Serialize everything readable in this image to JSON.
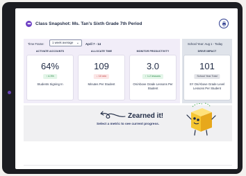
{
  "header": {
    "title": "Class Snapshot: Ms. Tan's Sixth Grade 7th Period"
  },
  "filters": {
    "time_frame_label": "Time Frame:",
    "time_frame_value": "1 week average",
    "date_range": "April 7 - 14"
  },
  "cards": [
    {
      "header": "ACTIVATE ACCOUNTS",
      "value": "64%",
      "badge": "↑ 4.3%",
      "label": "Students Signing In"
    },
    {
      "header": "ALLOCATE TIME",
      "value": "109",
      "badge": "↓ 10 min",
      "label": "Minutes Per Student"
    },
    {
      "header": "MONITOR PRODUCTIVITY",
      "value": "3.0",
      "badge": "↑ 1.2 lessons",
      "label": "On/Above Grade Lessons Per Student"
    }
  ],
  "drive_impact": {
    "school_year_label": "School Year: Aug 1 - Today",
    "header": "DRIVE IMPACT",
    "value": "101",
    "badge": "School Year Total",
    "label": "SY On/Above Grade Level Lessons Per Student"
  },
  "earned": {
    "title": "Zearned it!",
    "subtitle": "Select a metric to see current progress."
  },
  "colors": {
    "accent": "#6d3fc4",
    "up": "#2a8a48",
    "down": "#c23b3b",
    "panel": "#f1edf8",
    "panel_right": "#dfe3ea"
  },
  "icons": {
    "app": "app-logo-icon",
    "print": "print-icon",
    "chevron": "chevron-down-icon",
    "arrow": "curly-arrow-icon",
    "mascot": "zearn-mascot-icon"
  }
}
